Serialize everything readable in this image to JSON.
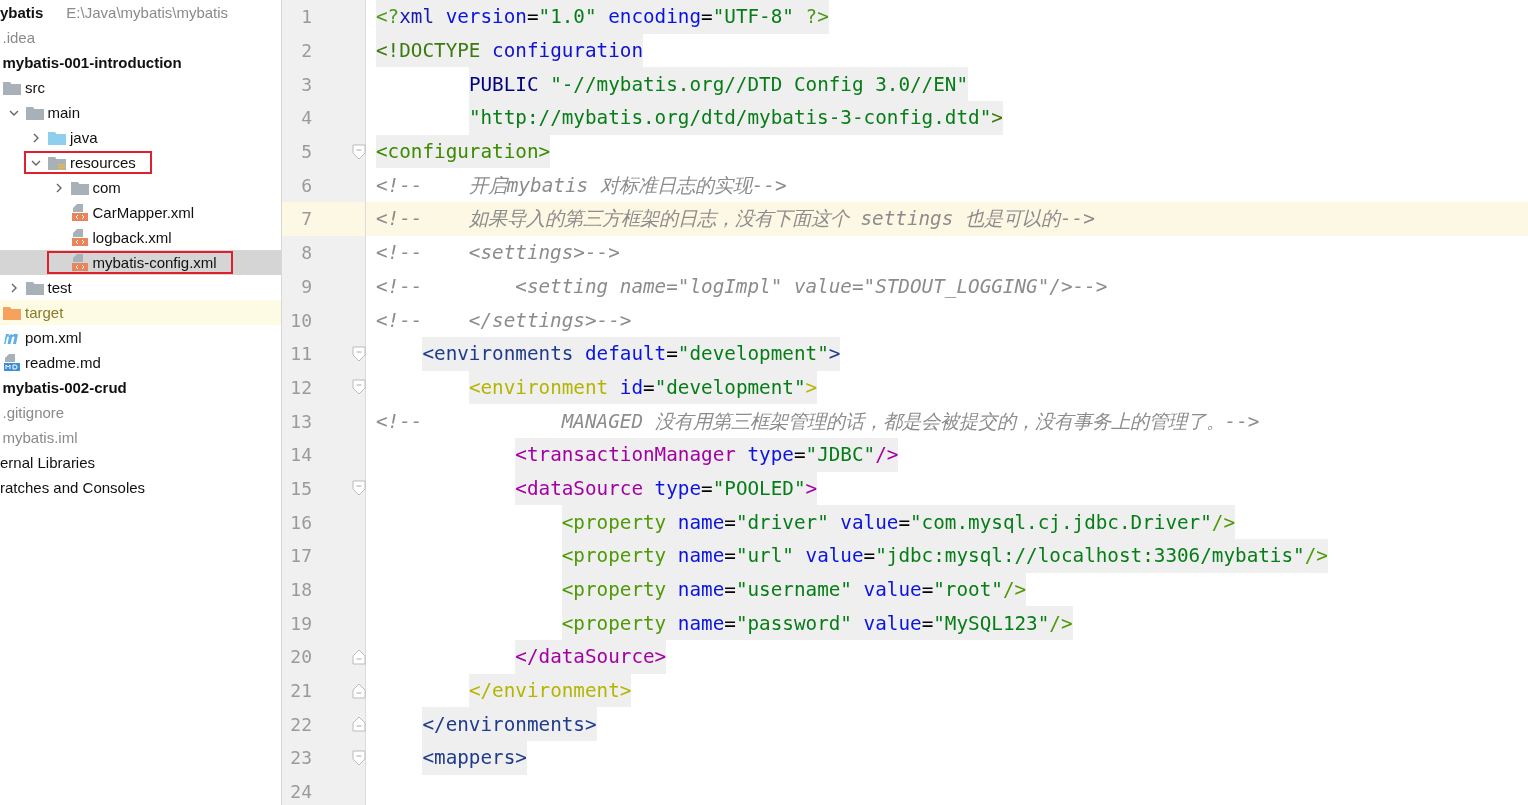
{
  "sidebar": {
    "items": [
      {
        "label": "ybatis",
        "kind": "module",
        "selected": false,
        "annotated": false,
        "path": "E:\\Java\\mybatis\\mybatis",
        "children": [
          {
            "label": ".idea",
            "kind": "ignored",
            "selected": false,
            "annotated": false
          },
          {
            "label": "mybatis-001-introduction",
            "kind": "module",
            "selected": false,
            "annotated": false,
            "children": [
              {
                "label": "src",
                "kind": "folder",
                "selected": false,
                "annotated": false,
                "children": [
                  {
                    "label": "main",
                    "kind": "folder",
                    "expanded": true,
                    "selected": false,
                    "annotated": false,
                    "children": [
                      {
                        "label": "java",
                        "kind": "source-folder",
                        "expanded": false,
                        "selected": false,
                        "annotated": false
                      },
                      {
                        "label": "resources",
                        "kind": "resource-folder",
                        "expanded": true,
                        "selected": false,
                        "annotated": true,
                        "children": [
                          {
                            "label": "com",
                            "kind": "folder",
                            "expanded": false,
                            "selected": false,
                            "annotated": false
                          },
                          {
                            "label": "CarMapper.xml",
                            "kind": "xml-file",
                            "selected": false,
                            "annotated": false
                          },
                          {
                            "label": "logback.xml",
                            "kind": "xml-file",
                            "selected": false,
                            "annotated": false
                          },
                          {
                            "label": "mybatis-config.xml",
                            "kind": "xml-file",
                            "selected": true,
                            "annotated": true
                          }
                        ]
                      }
                    ]
                  },
                  {
                    "label": "test",
                    "kind": "folder",
                    "expanded": false,
                    "selected": false,
                    "annotated": false
                  }
                ]
              },
              {
                "label": "target",
                "kind": "excluded-folder",
                "selected": false,
                "annotated": false
              },
              {
                "label": "pom.xml",
                "kind": "maven-file",
                "selected": false,
                "annotated": false
              },
              {
                "label": "readme.md",
                "kind": "markdown-file",
                "selected": false,
                "annotated": false
              }
            ]
          },
          {
            "label": "mybatis-002-crud",
            "kind": "module",
            "selected": false,
            "annotated": false
          },
          {
            "label": ".gitignore",
            "kind": "ignored",
            "selected": false,
            "annotated": false
          },
          {
            "label": "mybatis.iml",
            "kind": "ignored",
            "selected": false,
            "annotated": false
          }
        ]
      },
      {
        "label": "ernal Libraries",
        "kind": "plain",
        "selected": false,
        "annotated": false
      },
      {
        "label": "ratches and Consoles",
        "kind": "plain",
        "selected": false,
        "annotated": false
      }
    ]
  },
  "editor": {
    "lines": [
      {
        "number": "1",
        "kind": "plain",
        "highlighted": true,
        "current": false,
        "tokens": [
          {
            "kind": "tag-green",
            "text": "<?"
          },
          {
            "kind": "tag-blue",
            "text": "xml"
          },
          {
            "kind": "attr",
            "text": " version"
          },
          {
            "kind": "text",
            "text": "="
          },
          {
            "kind": "value",
            "text": "\"1.0\""
          },
          {
            "kind": "attr",
            "text": " encoding"
          },
          {
            "kind": "text",
            "text": "="
          },
          {
            "kind": "value",
            "text": "\"UTF-8\""
          },
          {
            "kind": "tag-green",
            "text": " ?>"
          }
        ]
      },
      {
        "number": "2",
        "kind": "plain",
        "highlighted": true,
        "current": false,
        "tokens": [
          {
            "kind": "tag-darkgreen",
            "text": "<!DOCTYPE"
          },
          {
            "kind": "tag-brightblue",
            "text": " configuration"
          }
        ]
      },
      {
        "number": "3",
        "kind": "plain",
        "highlighted": true,
        "current": false,
        "tokens": [
          {
            "kind": "keyword",
            "text": "        PUBLIC"
          },
          {
            "kind": "value",
            "text": " \"-//mybatis.org//DTD Config 3.0//EN\""
          }
        ]
      },
      {
        "number": "4",
        "kind": "plain",
        "highlighted": true,
        "current": false,
        "tokens": [
          {
            "kind": "value",
            "text": "        \"http://mybatis.org/dtd/mybatis-3-config.dtd\""
          },
          {
            "kind": "tag-darkgreen",
            "text": ">"
          }
        ]
      },
      {
        "number": "5",
        "kind": "fold-start",
        "highlighted": true,
        "current": false,
        "tokens": [
          {
            "kind": "tag-root",
            "text": "<configuration>"
          }
        ]
      },
      {
        "number": "6",
        "kind": "plain",
        "highlighted": false,
        "current": false,
        "tokens": [
          {
            "kind": "comment",
            "text": "<!--    开启mybatis 对标准日志的实现-->"
          }
        ]
      },
      {
        "number": "7",
        "kind": "plain",
        "highlighted": false,
        "current": true,
        "tokens": [
          {
            "kind": "comment",
            "text": "<!--    如果导入的第三方框架的日志，没有下面这个 settings 也是可以的-->"
          }
        ]
      },
      {
        "number": "8",
        "kind": "plain",
        "highlighted": false,
        "current": false,
        "tokens": [
          {
            "kind": "comment",
            "text": "<!--    <settings>-->"
          }
        ]
      },
      {
        "number": "9",
        "kind": "plain",
        "highlighted": false,
        "current": false,
        "tokens": [
          {
            "kind": "comment",
            "text": "<!--        <setting name=\"logImpl\" value=\"STDOUT_LOGGING\"/>-->"
          }
        ]
      },
      {
        "number": "10",
        "kind": "plain",
        "highlighted": false,
        "current": false,
        "tokens": [
          {
            "kind": "comment",
            "text": "<!--    </settings>-->"
          }
        ]
      },
      {
        "number": "11",
        "kind": "fold-start",
        "highlighted": true,
        "current": false,
        "tokens": [
          {
            "kind": "tag-navy",
            "text": "    <environments"
          },
          {
            "kind": "attr",
            "text": " default"
          },
          {
            "kind": "text",
            "text": "="
          },
          {
            "kind": "value",
            "text": "\"development\""
          },
          {
            "kind": "tag-navy",
            "text": ">"
          }
        ]
      },
      {
        "number": "12",
        "kind": "fold-start",
        "highlighted": true,
        "current": false,
        "tokens": [
          {
            "kind": "tag-olive",
            "text": "        <environment"
          },
          {
            "kind": "attr",
            "text": " id"
          },
          {
            "kind": "text",
            "text": "="
          },
          {
            "kind": "value",
            "text": "\"development\""
          },
          {
            "kind": "tag-olive",
            "text": ">"
          }
        ]
      },
      {
        "number": "13",
        "kind": "plain",
        "highlighted": false,
        "current": false,
        "tokens": [
          {
            "kind": "comment",
            "text": "<!--            MANAGED 没有用第三框架管理的话，都是会被提交的，没有事务上的管理了。-->"
          }
        ]
      },
      {
        "number": "14",
        "kind": "plain",
        "highlighted": true,
        "current": false,
        "tokens": [
          {
            "kind": "tag-magenta",
            "text": "            <transactionManager"
          },
          {
            "kind": "attr",
            "text": " type"
          },
          {
            "kind": "text",
            "text": "="
          },
          {
            "kind": "value",
            "text": "\"JDBC\""
          },
          {
            "kind": "tag-magenta",
            "text": "/>"
          }
        ]
      },
      {
        "number": "15",
        "kind": "fold-start",
        "highlighted": true,
        "current": false,
        "tokens": [
          {
            "kind": "tag-magenta",
            "text": "            <dataSource"
          },
          {
            "kind": "attr",
            "text": " type"
          },
          {
            "kind": "text",
            "text": "="
          },
          {
            "kind": "value",
            "text": "\"POOLED\""
          },
          {
            "kind": "tag-magenta",
            "text": ">"
          }
        ]
      },
      {
        "number": "16",
        "kind": "plain",
        "highlighted": true,
        "current": false,
        "tokens": [
          {
            "kind": "tag-lime",
            "text": "                <property"
          },
          {
            "kind": "attr",
            "text": " name"
          },
          {
            "kind": "text",
            "text": "="
          },
          {
            "kind": "value",
            "text": "\"driver\""
          },
          {
            "kind": "attr",
            "text": " value"
          },
          {
            "kind": "text",
            "text": "="
          },
          {
            "kind": "value",
            "text": "\"com.mysql.cj.jdbc.Driver\""
          },
          {
            "kind": "tag-lime",
            "text": "/>"
          }
        ]
      },
      {
        "number": "17",
        "kind": "plain",
        "highlighted": true,
        "current": false,
        "tokens": [
          {
            "kind": "tag-lime",
            "text": "                <property"
          },
          {
            "kind": "attr",
            "text": " name"
          },
          {
            "kind": "text",
            "text": "="
          },
          {
            "kind": "value",
            "text": "\"url\""
          },
          {
            "kind": "attr",
            "text": " value"
          },
          {
            "kind": "text",
            "text": "="
          },
          {
            "kind": "value",
            "text": "\"jdbc:mysql://localhost:3306/mybatis\""
          },
          {
            "kind": "tag-lime",
            "text": "/>"
          }
        ]
      },
      {
        "number": "18",
        "kind": "plain",
        "highlighted": true,
        "current": false,
        "tokens": [
          {
            "kind": "tag-lime",
            "text": "                <property"
          },
          {
            "kind": "attr",
            "text": " name"
          },
          {
            "kind": "text",
            "text": "="
          },
          {
            "kind": "value",
            "text": "\"username\""
          },
          {
            "kind": "attr",
            "text": " value"
          },
          {
            "kind": "text",
            "text": "="
          },
          {
            "kind": "value",
            "text": "\"root\""
          },
          {
            "kind": "tag-lime",
            "text": "/>"
          }
        ]
      },
      {
        "number": "19",
        "kind": "plain",
        "highlighted": true,
        "current": false,
        "tokens": [
          {
            "kind": "tag-lime",
            "text": "                <property"
          },
          {
            "kind": "attr",
            "text": " name"
          },
          {
            "kind": "text",
            "text": "="
          },
          {
            "kind": "value",
            "text": "\"password\""
          },
          {
            "kind": "attr",
            "text": " value"
          },
          {
            "kind": "text",
            "text": "="
          },
          {
            "kind": "value",
            "text": "\"MySQL123\""
          },
          {
            "kind": "tag-lime",
            "text": "/>"
          }
        ]
      },
      {
        "number": "20",
        "kind": "fold-end",
        "highlighted": true,
        "current": false,
        "tokens": [
          {
            "kind": "tag-magenta",
            "text": "            </dataSource>"
          }
        ]
      },
      {
        "number": "21",
        "kind": "fold-end",
        "highlighted": true,
        "current": false,
        "tokens": [
          {
            "kind": "tag-olive",
            "text": "        </environment>"
          }
        ]
      },
      {
        "number": "22",
        "kind": "fold-end",
        "highlighted": true,
        "current": false,
        "tokens": [
          {
            "kind": "tag-navy",
            "text": "    </environments>"
          }
        ]
      },
      {
        "number": "23",
        "kind": "fold-start",
        "highlighted": true,
        "current": false,
        "tokens": [
          {
            "kind": "tag-navy",
            "text": "    <mappers>"
          }
        ]
      },
      {
        "number": "24",
        "kind": "plain",
        "current": false
      }
    ]
  }
}
